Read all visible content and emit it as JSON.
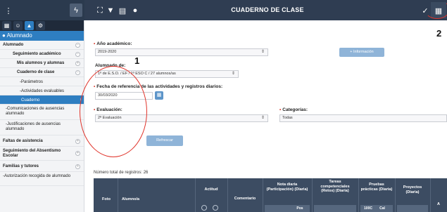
{
  "topbar": {
    "title": "CUADERNO DE CLASE",
    "left_icons": [
      "menu-icon",
      "lightning-icon",
      "expand-icon",
      "filter-icon",
      "document-icon",
      "briefcase-icon"
    ],
    "right_icons": [
      "check-icon",
      "table-icon"
    ]
  },
  "sidebar": {
    "tabs": [
      "tab-home",
      "tab-users",
      "tab-education",
      "tab-settings"
    ],
    "section": "Alumnado",
    "items": [
      {
        "label": "Alumnado",
        "toggle": "−"
      },
      {
        "label": "Seguimiento académico",
        "toggle": "−"
      },
      {
        "label": "Mis alumnos y alumnas",
        "toggle": "+"
      },
      {
        "label": "Cuaderno de clase",
        "toggle": "−"
      },
      {
        "label": "-Parámetros"
      },
      {
        "label": "-Actividades evaluables"
      },
      {
        "label": "Cuaderno"
      },
      {
        "label": "-Comunicaciones de ausencias alumnado"
      },
      {
        "label": "-Justificaciones de ausencias alumnado"
      },
      {
        "label": "Faltas de asistencia",
        "toggle": "+"
      },
      {
        "label": "Seguimiento del Absentismo Escolar",
        "toggle": "+"
      },
      {
        "label": "Familias y tutores",
        "toggle": "+"
      },
      {
        "label": "-Autorización recogida de alumnado"
      }
    ]
  },
  "form": {
    "year_label": "Año académico:",
    "year_value": "2019-2020",
    "info_button": "+ Información",
    "class_label": "Alumnado de:",
    "class_value": "1º de E.S.O. / EF / 1º ESO C / 27 alumnos/as",
    "date_label": "Fecha de referencia de las actividades y registros diarios:",
    "date_value": "30/03/2020",
    "eval_label": "Evaluación:",
    "eval_value": "2ª Evaluación",
    "cat_label": "Categorías:",
    "cat_value": "Todas",
    "refresh_button": "Refrescar"
  },
  "table": {
    "count_text": "Número total de registros: 26",
    "headers": {
      "foto": "Foto",
      "alumno": "Alumno/a",
      "actitud": "Actitud",
      "comentario": "Comentario",
      "nota_diaria": "Nota diaria (Participación) (Diaria)",
      "tareas": "Tareas competenciales (Retos) (Diaria)",
      "pruebas": "Pruebas prácticas (Diaria)",
      "proyectos": "Proyectos (Diaria)",
      "cut": "A"
    },
    "sub_headers": {
      "pos": "Pos",
      "cal": "Cal",
      "pct": "100C"
    }
  },
  "annotations": {
    "one": "1",
    "two": "2"
  },
  "colors": {
    "accent": "#2e7ec1",
    "topbar": "#2f3d52",
    "annotation": "#e0332a"
  }
}
